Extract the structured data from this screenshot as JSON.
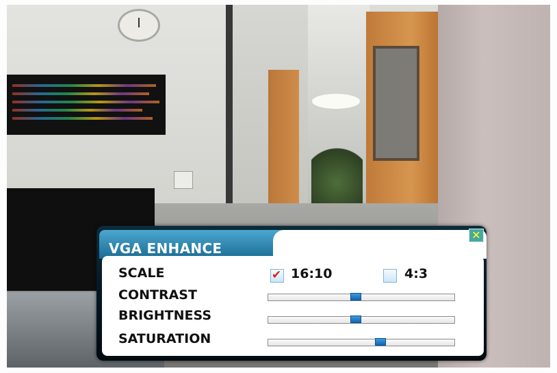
{
  "dialog": {
    "title": "VGA ENHANCE",
    "close_icon": "close-x-icon",
    "colors": {
      "title_tab": "#2f8ab6",
      "frame": "#041621",
      "slider_thumb": "#1e7ed0",
      "check_mark": "#e02020"
    }
  },
  "scale": {
    "label": "SCALE",
    "options": [
      {
        "label": "16:10",
        "checked": true
      },
      {
        "label": "4:3",
        "checked": false
      }
    ]
  },
  "contrast": {
    "label": "CONTRAST",
    "value": 0.47
  },
  "brightness": {
    "label": "BRIGHTNESS",
    "value": 0.47
  },
  "saturation": {
    "label": "SATURATION",
    "value": 0.61
  }
}
